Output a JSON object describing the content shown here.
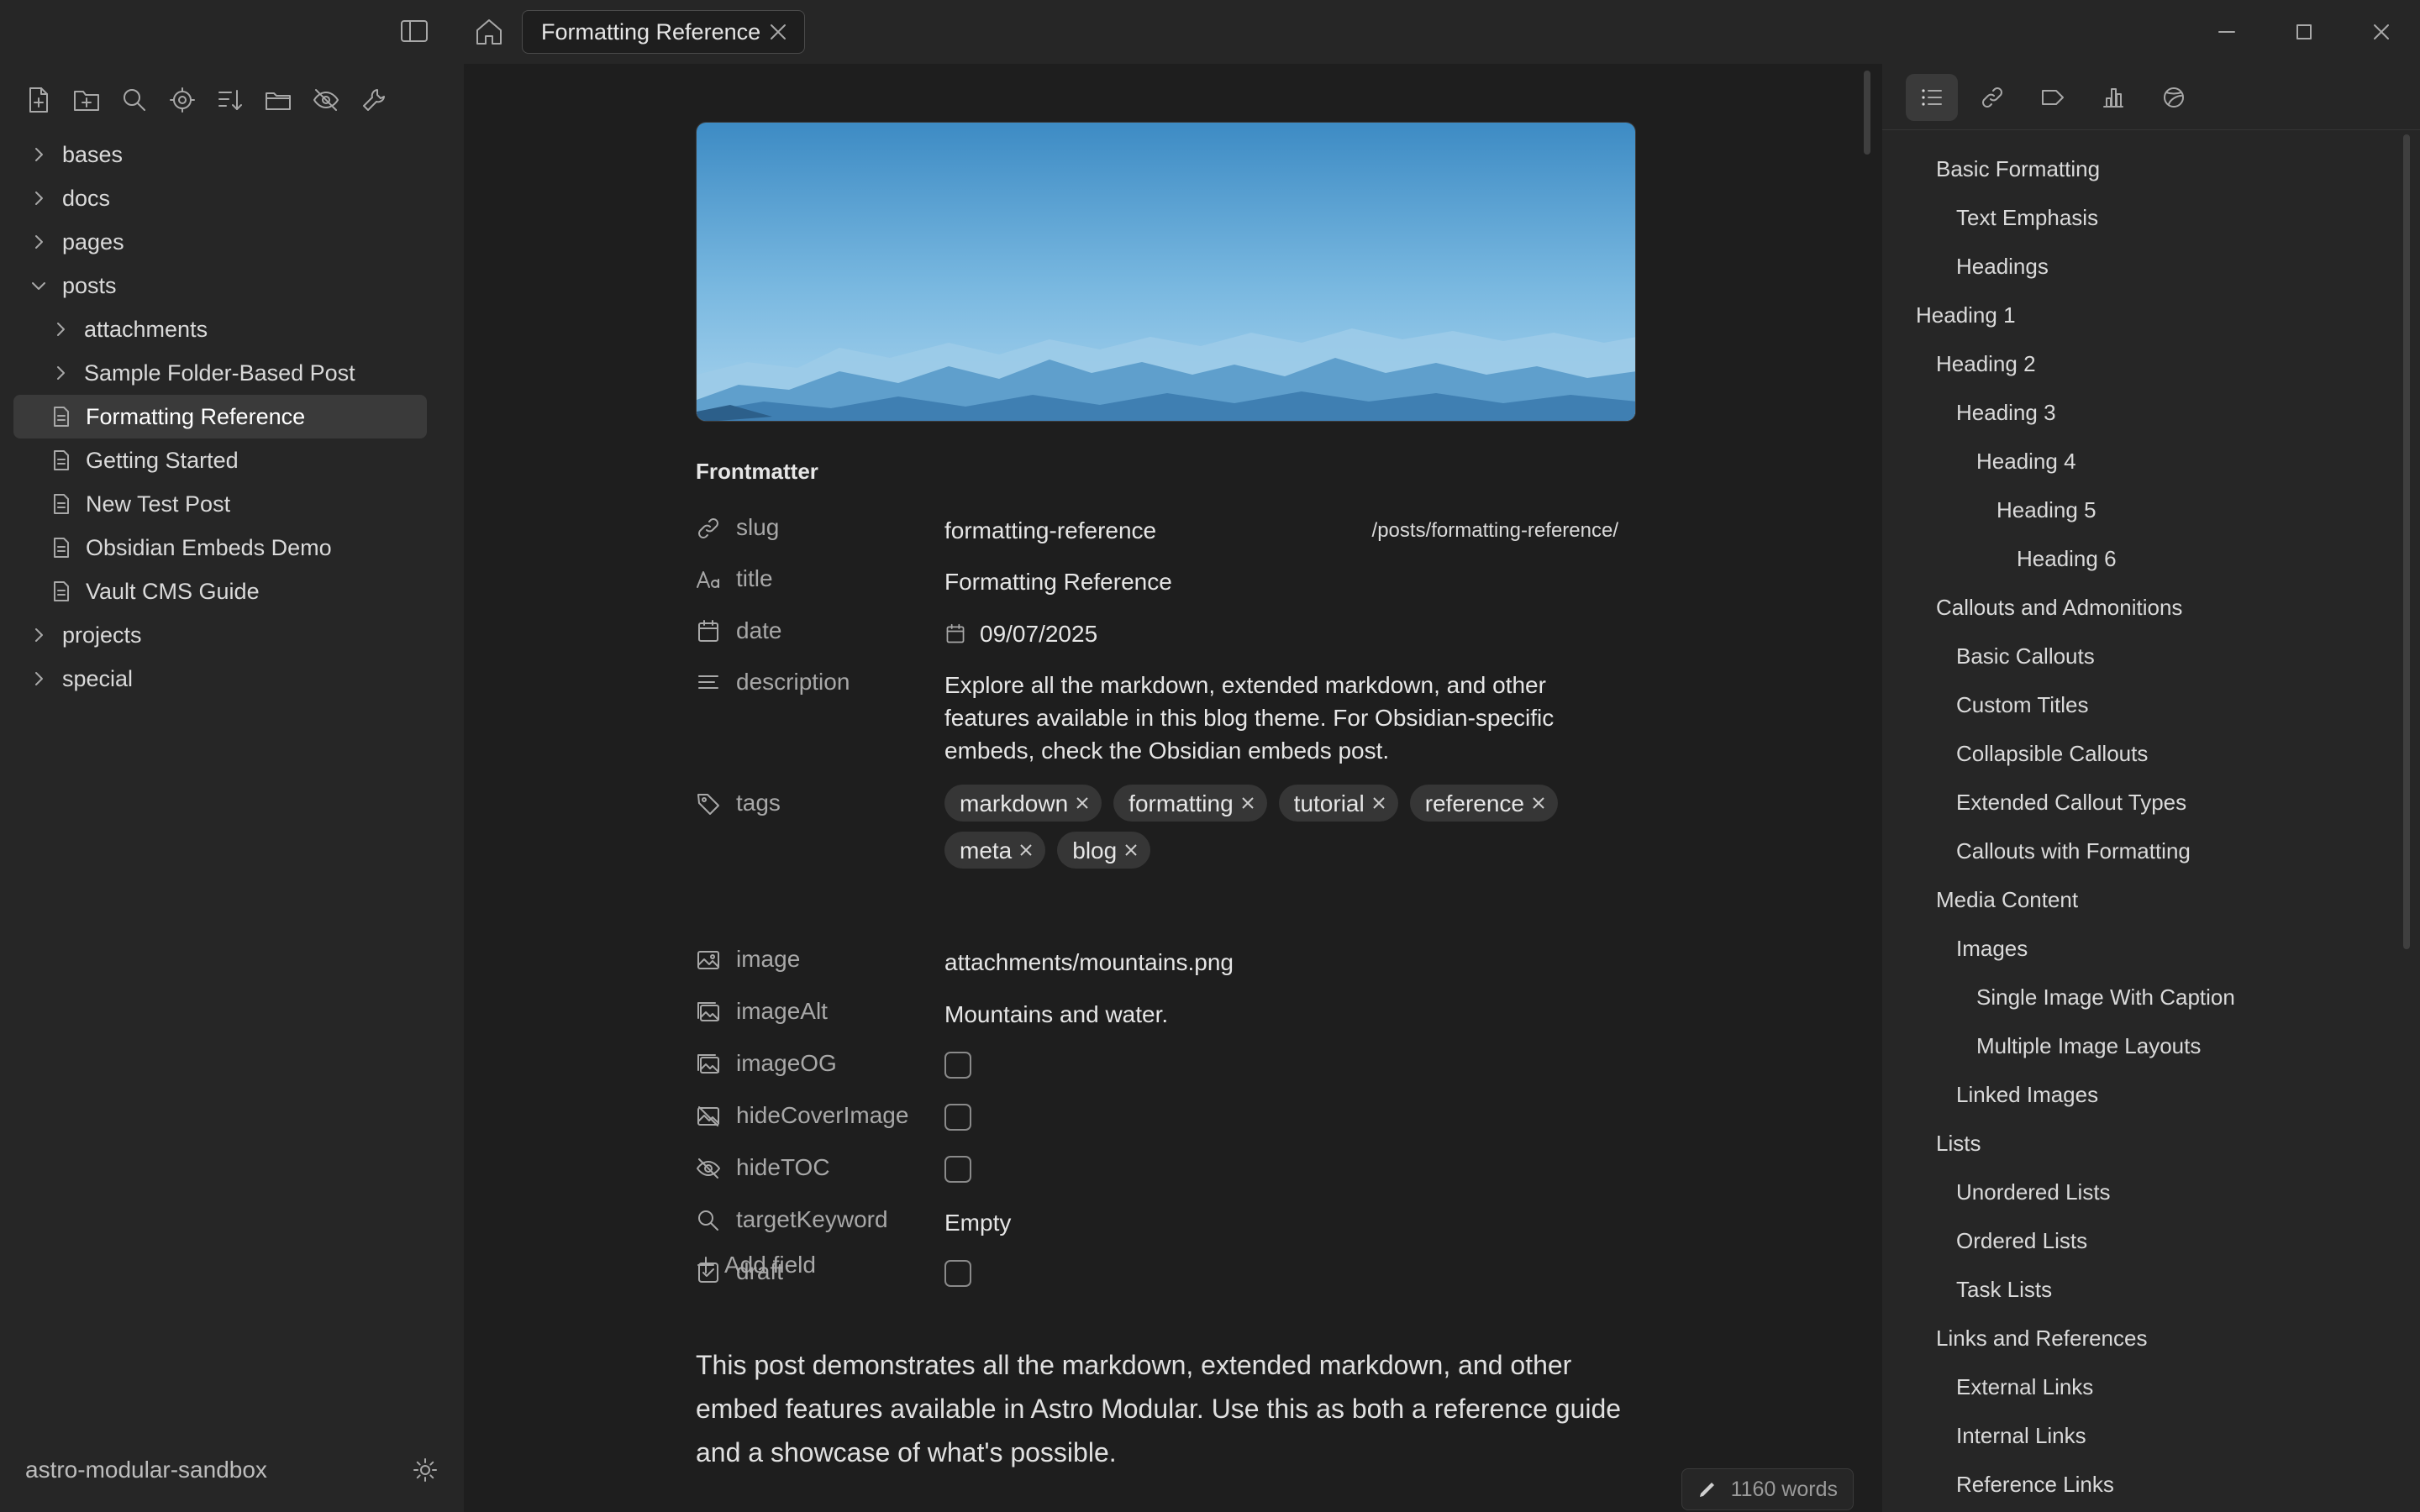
{
  "tab": {
    "title": "Formatting Reference"
  },
  "file_tree": [
    {
      "label": "bases",
      "type": "folder",
      "expanded": false,
      "level": 0
    },
    {
      "label": "docs",
      "type": "folder",
      "expanded": false,
      "level": 0
    },
    {
      "label": "pages",
      "type": "folder",
      "expanded": false,
      "level": 0
    },
    {
      "label": "posts",
      "type": "folder",
      "expanded": true,
      "level": 0
    },
    {
      "label": "attachments",
      "type": "folder",
      "expanded": false,
      "level": 1
    },
    {
      "label": "Sample Folder-Based Post",
      "type": "folder",
      "expanded": false,
      "level": 1
    },
    {
      "label": "Formatting Reference",
      "type": "file",
      "active": true,
      "level": 1
    },
    {
      "label": "Getting Started",
      "type": "file",
      "level": 1
    },
    {
      "label": "New Test Post",
      "type": "file",
      "level": 1
    },
    {
      "label": "Obsidian Embeds Demo",
      "type": "file",
      "level": 1
    },
    {
      "label": "Vault CMS Guide",
      "type": "file",
      "level": 1
    },
    {
      "label": "projects",
      "type": "folder",
      "expanded": false,
      "level": 0
    },
    {
      "label": "special",
      "type": "folder",
      "expanded": false,
      "level": 0
    }
  ],
  "vault": {
    "name": "astro-modular-sandbox"
  },
  "frontmatter": {
    "heading": "Frontmatter",
    "slug": {
      "key": "slug",
      "value": "formatting-reference",
      "url": "/posts/formatting-reference/"
    },
    "title": {
      "key": "title",
      "value": "Formatting Reference"
    },
    "date": {
      "key": "date",
      "value": "09/07/2025"
    },
    "description": {
      "key": "description",
      "value": "Explore all the markdown, extended markdown, and other features available in this blog theme. For Obsidian-specific embeds, check the Obsidian embeds post."
    },
    "tags": {
      "key": "tags",
      "values": [
        "markdown",
        "formatting",
        "tutorial",
        "reference",
        "meta",
        "blog"
      ]
    },
    "image": {
      "key": "image",
      "value": "attachments/mountains.png"
    },
    "imageAlt": {
      "key": "imageAlt",
      "value": "Mountains and water."
    },
    "imageOG": {
      "key": "imageOG",
      "checked": false
    },
    "hideCoverImage": {
      "key": "hideCoverImage",
      "checked": false
    },
    "hideTOC": {
      "key": "hideTOC",
      "checked": false
    },
    "targetKeyword": {
      "key": "targetKeyword",
      "value": "Empty"
    },
    "draft": {
      "key": "draft",
      "checked": false
    },
    "add_field": "Add field"
  },
  "body": {
    "paragraph": "This post demonstrates all the markdown, extended markdown, and other embed features available in Astro Modular. Use this as both a reference guide and a showcase of what's possible."
  },
  "status": {
    "word_count": "1160 words"
  },
  "outline": [
    {
      "label": "Basic Formatting",
      "level": 2
    },
    {
      "label": "Text Emphasis",
      "level": 3
    },
    {
      "label": "Headings",
      "level": 3
    },
    {
      "label": "Heading 1",
      "level": 1
    },
    {
      "label": "Heading 2",
      "level": 2
    },
    {
      "label": "Heading 3",
      "level": 3
    },
    {
      "label": "Heading 4",
      "level": 4
    },
    {
      "label": "Heading 5",
      "level": 5
    },
    {
      "label": "Heading 6",
      "level": 6
    },
    {
      "label": "Callouts and Admonitions",
      "level": 2
    },
    {
      "label": "Basic Callouts",
      "level": 3
    },
    {
      "label": "Custom Titles",
      "level": 3
    },
    {
      "label": "Collapsible Callouts",
      "level": 3
    },
    {
      "label": "Extended Callout Types",
      "level": 3
    },
    {
      "label": "Callouts with Formatting",
      "level": 3
    },
    {
      "label": "Media Content",
      "level": 2
    },
    {
      "label": "Images",
      "level": 3
    },
    {
      "label": "Single Image With Caption",
      "level": 4
    },
    {
      "label": "Multiple Image Layouts",
      "level": 4
    },
    {
      "label": "Linked Images",
      "level": 3
    },
    {
      "label": "Lists",
      "level": 2
    },
    {
      "label": "Unordered Lists",
      "level": 3
    },
    {
      "label": "Ordered Lists",
      "level": 3
    },
    {
      "label": "Task Lists",
      "level": 3
    },
    {
      "label": "Links and References",
      "level": 2
    },
    {
      "label": "External Links",
      "level": 3
    },
    {
      "label": "Internal Links",
      "level": 3
    },
    {
      "label": "Reference Links",
      "level": 3
    }
  ],
  "colors": {
    "background": "#1e1e1e",
    "sidebar": "#262626",
    "active_item": "#3a3a3a",
    "tag_pill": "#363636"
  }
}
